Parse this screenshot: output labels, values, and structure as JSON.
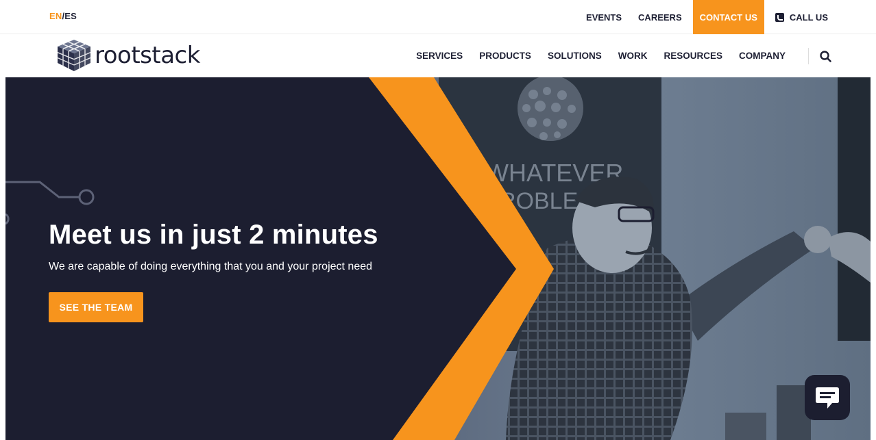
{
  "lang": {
    "active": "EN",
    "separator": "/",
    "inactive": "ES"
  },
  "top_nav": {
    "events": "EVENTS",
    "careers": "CAREERS",
    "contact": "CONTACT US",
    "call": "CALL US"
  },
  "brand": {
    "name": "rootstack"
  },
  "main_nav": {
    "items": [
      "SERVICES",
      "PRODUCTS",
      "SOLUTIONS",
      "WORK",
      "RESOURCES",
      "COMPANY"
    ]
  },
  "hero": {
    "title": "Meet us in just 2 minutes",
    "subtitle": "We are capable of doing everything that you and your project need",
    "cta": "SEE THE TEAM",
    "wall_text_1": "WHATEVER",
    "wall_text_2": "ROBLE"
  },
  "colors": {
    "accent": "#f7941d",
    "navy": "#1c1e30",
    "text": "#1d1f33"
  },
  "icons": {
    "search": "search-icon",
    "phone": "phone-icon",
    "chat": "chat-icon"
  }
}
